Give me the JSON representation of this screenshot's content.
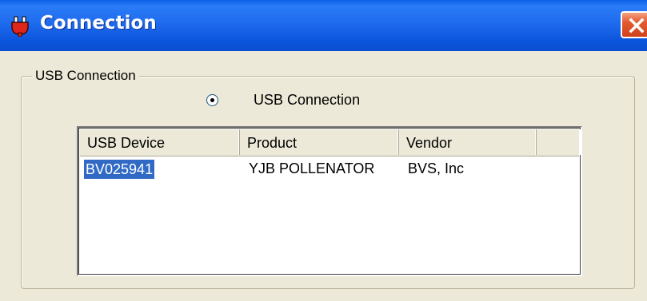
{
  "window": {
    "title": "Connection",
    "app_icon": "plug-icon",
    "close_icon": "close-icon"
  },
  "group": {
    "legend": "USB Connection",
    "radio": {
      "label": "USB Connection",
      "checked": true
    }
  },
  "device_list": {
    "columns": [
      "USB Device",
      "Product",
      "Vendor"
    ],
    "rows": [
      {
        "device": "BV025941",
        "product": "YJB POLLENATOR",
        "vendor": "BVS, Inc",
        "selected": true
      }
    ]
  },
  "colors": {
    "titlebar": "#0a5fe8",
    "selection": "#316ac5",
    "close_button": "#e55a2f",
    "window_bg": "#ece9d8"
  }
}
